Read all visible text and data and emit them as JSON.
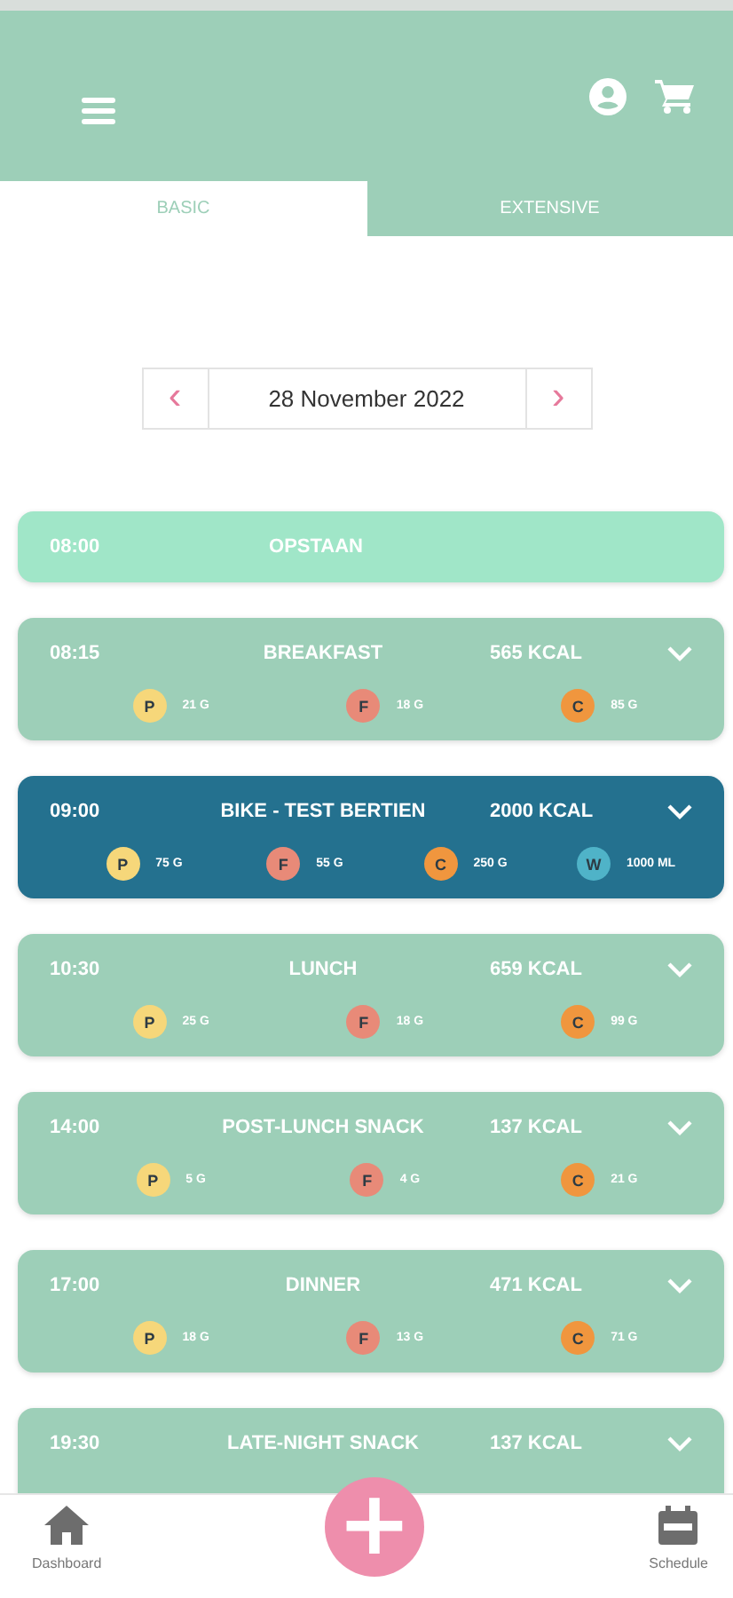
{
  "tabs": [
    {
      "label": "BASIC",
      "selected": true
    },
    {
      "label": "EXTENSIVE",
      "selected": false
    }
  ],
  "date_picker": {
    "prev": "‹",
    "date": "28 November 2022",
    "next": "›"
  },
  "entries": [
    {
      "kind": "event",
      "time": "08:00",
      "title": "OPSTAAN"
    },
    {
      "kind": "meal",
      "time": "08:15",
      "title": "BREAKFAST",
      "kcal": "565 KCAL",
      "macros": [
        {
          "letter": "P",
          "amount": "21 G",
          "color": "#f6d77a"
        },
        {
          "letter": "F",
          "amount": "18 G",
          "color": "#e88a78"
        },
        {
          "letter": "C",
          "amount": "85 G",
          "color": "#f0963e"
        }
      ]
    },
    {
      "kind": "workout",
      "time": "09:00",
      "title": "BIKE - TEST BERTIEN",
      "kcal": "2000 KCAL",
      "macros": [
        {
          "letter": "P",
          "amount": "75 G",
          "color": "#f6d77a"
        },
        {
          "letter": "F",
          "amount": "55 G",
          "color": "#e88a78"
        },
        {
          "letter": "C",
          "amount": "250 G",
          "color": "#f0963e"
        },
        {
          "letter": "W",
          "amount": "1000 ML",
          "color": "#4fb3c8"
        }
      ]
    },
    {
      "kind": "meal",
      "time": "10:30",
      "title": "LUNCH",
      "kcal": "659 KCAL",
      "macros": [
        {
          "letter": "P",
          "amount": "25 G",
          "color": "#f6d77a"
        },
        {
          "letter": "F",
          "amount": "18 G",
          "color": "#e88a78"
        },
        {
          "letter": "C",
          "amount": "99 G",
          "color": "#f0963e"
        }
      ]
    },
    {
      "kind": "meal",
      "time": "14:00",
      "title": "POST-LUNCH SNACK",
      "kcal": "137 KCAL",
      "macros": [
        {
          "letter": "P",
          "amount": "5 G",
          "color": "#f6d77a"
        },
        {
          "letter": "F",
          "amount": "4 G",
          "color": "#e88a78"
        },
        {
          "letter": "C",
          "amount": "21 G",
          "color": "#f0963e"
        }
      ]
    },
    {
      "kind": "meal",
      "time": "17:00",
      "title": "DINNER",
      "kcal": "471 KCAL",
      "macros": [
        {
          "letter": "P",
          "amount": "18 G",
          "color": "#f6d77a"
        },
        {
          "letter": "F",
          "amount": "13 G",
          "color": "#e88a78"
        },
        {
          "letter": "C",
          "amount": "71 G",
          "color": "#f0963e"
        }
      ]
    },
    {
      "kind": "meal",
      "time": "19:30",
      "title": "LATE-NIGHT SNACK",
      "kcal": "137 KCAL"
    }
  ],
  "bottom_nav": {
    "left": "Dashboard",
    "fab": "+",
    "right": "Schedule"
  }
}
